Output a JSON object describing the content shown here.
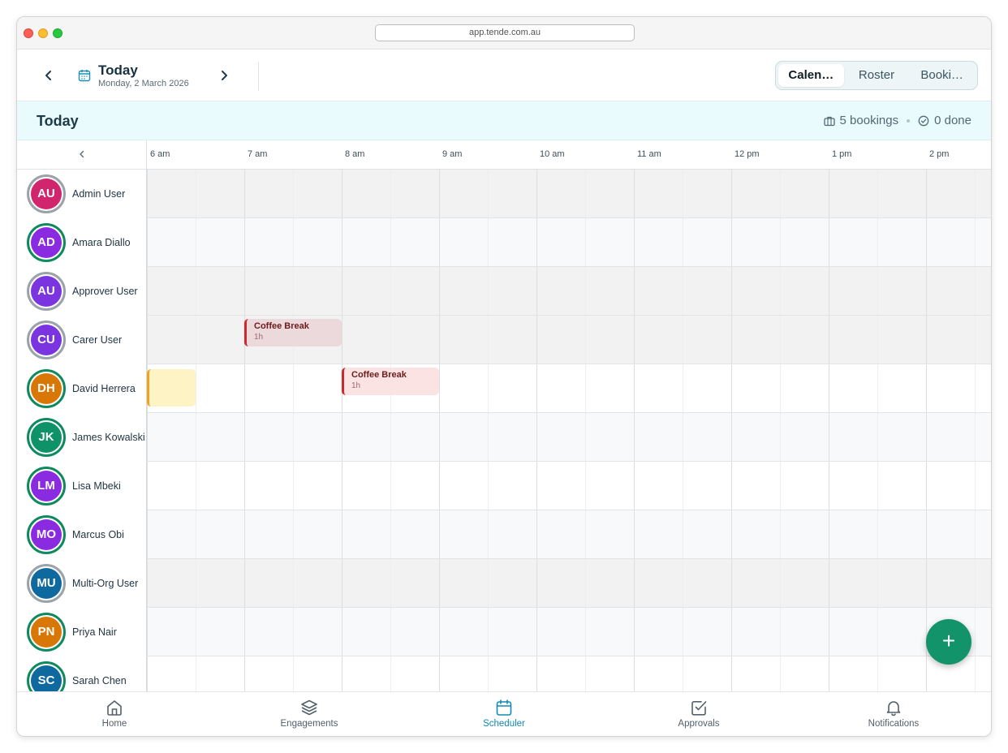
{
  "browser": {
    "url": "app.tende.com.au"
  },
  "toolbar": {
    "prev_label": "‹",
    "next_label": "›",
    "date_title": "Today",
    "date_subtitle": "Monday, 2 March 2026",
    "views": [
      {
        "label": "Calen…",
        "active": true
      },
      {
        "label": "Roster",
        "active": false
      },
      {
        "label": "Booki…",
        "active": false
      }
    ]
  },
  "dayband": {
    "title": "Today",
    "bookings": "5 bookings",
    "done": "0 done"
  },
  "timeline": {
    "collapse_label": "‹",
    "hours": [
      "6 am",
      "7 am",
      "8 am",
      "9 am",
      "10 am",
      "11 am",
      "12 pm",
      "1 pm",
      "2 pm"
    ]
  },
  "staff": [
    {
      "initials": "AU",
      "name": "Admin User",
      "color": "#d1266d",
      "ring": "gray"
    },
    {
      "initials": "AD",
      "name": "Amara Diallo",
      "color": "#8a2be2",
      "ring": "green"
    },
    {
      "initials": "AU",
      "name": "Approver User",
      "color": "#7b35e0",
      "ring": "gray"
    },
    {
      "initials": "CU",
      "name": "Carer User",
      "color": "#7b35e0",
      "ring": "gray"
    },
    {
      "initials": "DH",
      "name": "David Herrera",
      "color": "#d97706",
      "ring": "green"
    },
    {
      "initials": "JK",
      "name": "James Kowalski",
      "color": "#0f9268",
      "ring": "green"
    },
    {
      "initials": "LM",
      "name": "Lisa Mbeki",
      "color": "#8a2be2",
      "ring": "green"
    },
    {
      "initials": "MO",
      "name": "Marcus Obi",
      "color": "#8a2be2",
      "ring": "green"
    },
    {
      "initials": "MU",
      "name": "Multi-Org User",
      "color": "#0e6a9e",
      "ring": "gray"
    },
    {
      "initials": "PN",
      "name": "Priya Nair",
      "color": "#d97706",
      "ring": "green"
    },
    {
      "initials": "SC",
      "name": "Sarah Chen",
      "color": "#0e6a9e",
      "ring": "green"
    }
  ],
  "events": [
    {
      "staff_index": 3,
      "title": "Coffee Break",
      "duration": "1h",
      "start": "7:00",
      "end": "8:00",
      "style": "red-dim"
    },
    {
      "staff_index": 4,
      "title": "",
      "duration": "",
      "start": "6:00",
      "end": "6:30",
      "style": "yellow"
    },
    {
      "staff_index": 4,
      "title": "Coffee Break",
      "duration": "1h",
      "start": "8:00",
      "end": "9:00",
      "style": "red"
    }
  ],
  "fab": {
    "label": "+"
  },
  "bottom_nav": [
    {
      "label": "Home",
      "icon": "home-icon",
      "active": false
    },
    {
      "label": "Engagements",
      "icon": "layers-icon",
      "active": false
    },
    {
      "label": "Scheduler",
      "icon": "calendar-icon",
      "active": true
    },
    {
      "label": "Approvals",
      "icon": "check-square-icon",
      "active": false
    },
    {
      "label": "Notifications",
      "icon": "bell-icon",
      "active": false
    }
  ],
  "colors": {
    "accent": "#1189b6",
    "fab": "#13936a",
    "dayband": "#e9fbfd",
    "event_red": "#d1262c",
    "event_yellow": "#f4a320"
  }
}
